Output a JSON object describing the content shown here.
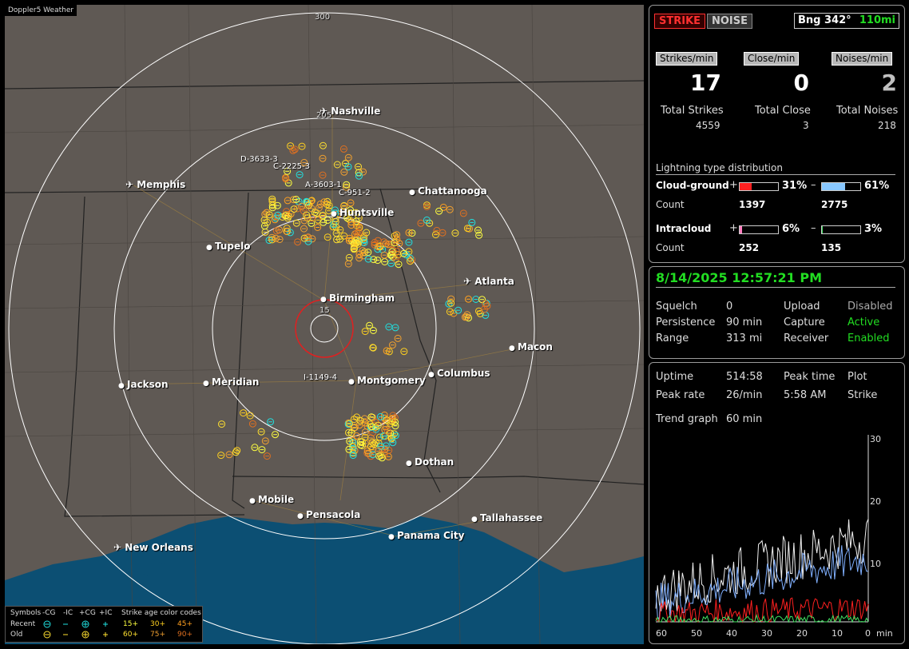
{
  "app_title": "Doppler5 Weather",
  "map": {
    "range_labels": [
      "300",
      "205",
      "15"
    ],
    "cities": [
      {
        "name": "Nashville",
        "airport": true
      },
      {
        "name": "Memphis",
        "airport": true
      },
      {
        "name": "Chattanooga",
        "airport": false
      },
      {
        "name": "Huntsville",
        "airport": false
      },
      {
        "name": "Tupelo",
        "airport": false
      },
      {
        "name": "Atlanta",
        "airport": true
      },
      {
        "name": "Birmingham",
        "airport": false
      },
      {
        "name": "Macon",
        "airport": false
      },
      {
        "name": "Jackson",
        "airport": false
      },
      {
        "name": "Meridian",
        "airport": false
      },
      {
        "name": "Montgomery",
        "airport": false
      },
      {
        "name": "Columbus",
        "airport": false
      },
      {
        "name": "Dothan",
        "airport": false
      },
      {
        "name": "Mobile",
        "airport": false
      },
      {
        "name": "Pensacola",
        "airport": false
      },
      {
        "name": "Tallahassee",
        "airport": false
      },
      {
        "name": "Panama City",
        "airport": false
      },
      {
        "name": "New Orleans",
        "airport": true
      }
    ],
    "storm_ids": [
      "D-3633-3",
      "C-2225-3",
      "A-3603-1",
      "C-951-2",
      "I-1149-4"
    ]
  },
  "legend": {
    "header_symbols": "Symbols",
    "cols": [
      "-CG",
      "-IC",
      "+CG",
      "+IC"
    ],
    "age_header": "Strike age color codes",
    "recent_label": "Recent",
    "old_label": "Old",
    "recent_ages": [
      "15+",
      "30+",
      "45+"
    ],
    "old_ages": [
      "60+",
      "75+",
      "90+"
    ]
  },
  "stats": {
    "strike_btn": "STRIKE",
    "noise_btn": "NOISE",
    "bearing_label": "Bng 342°",
    "bearing_range": "110mi",
    "strikes_min_label": "Strikes/min",
    "close_min_label": "Close/min",
    "noises_min_label": "Noises/min",
    "strikes_min": "17",
    "close_min": "0",
    "noises_min": "2",
    "total_strikes_label": "Total Strikes",
    "total_close_label": "Total Close",
    "total_noises_label": "Total Noises",
    "total_strikes": "4559",
    "total_close": "3",
    "total_noises": "218",
    "dist_title": "Lightning type distribution",
    "cg_label": "Cloud-ground",
    "ic_label": "Intracloud",
    "count_label": "Count",
    "plus": "+",
    "minus": "–",
    "cg_pos_pct": "31%",
    "cg_neg_pct": "61%",
    "cg_pos_count": "1397",
    "cg_neg_count": "2775",
    "ic_pos_pct": "6%",
    "ic_neg_pct": "3%",
    "ic_pos_count": "252",
    "ic_neg_count": "135",
    "cg_pos_frac": 0.31,
    "cg_neg_frac": 0.61,
    "ic_pos_frac": 0.06,
    "ic_neg_frac": 0.03
  },
  "status": {
    "datetime": "8/14/2025 12:57:21 PM",
    "squelch_label": "Squelch",
    "squelch": "0",
    "persistence_label": "Persistence",
    "persistence": "90 min",
    "range_label": "Range",
    "range": "313 mi",
    "upload_label": "Upload",
    "upload": "Disabled",
    "capture_label": "Capture",
    "capture": "Active",
    "receiver_label": "Receiver",
    "receiver": "Enabled"
  },
  "trend": {
    "uptime_label": "Uptime",
    "uptime": "514:58",
    "peak_time_label": "Peak time",
    "peak_time": "5:58 AM",
    "plot_label": "Plot",
    "plot": "Strike",
    "peak_rate_label": "Peak rate",
    "peak_rate": "26/min",
    "trend_label": "Trend graph",
    "trend_value": "60 min",
    "y_ticks": [
      "30",
      "20",
      "10"
    ],
    "x_ticks": [
      "60",
      "50",
      "40",
      "30",
      "20",
      "10",
      "0"
    ],
    "x_unit": "min"
  },
  "colors": {
    "strike_red": "#ff2020",
    "green": "#22dd22",
    "recent": "#20e0e0",
    "age15": "#ffff40",
    "age30": "#ffd020",
    "age45": "#ffa020",
    "age60": "#ffe030",
    "age75": "#f0a030",
    "age90": "#e07020"
  }
}
